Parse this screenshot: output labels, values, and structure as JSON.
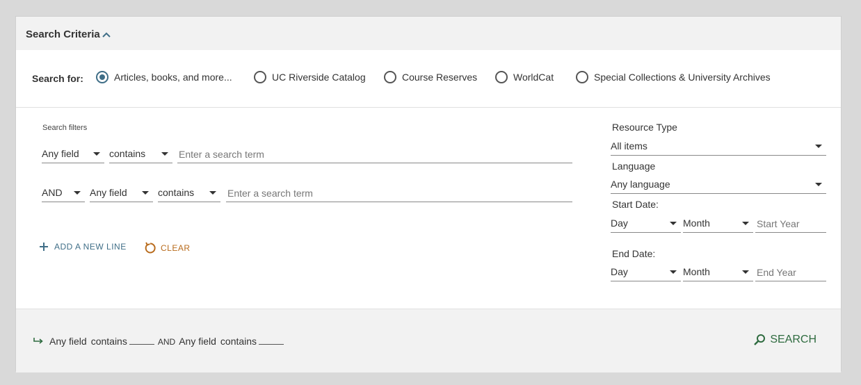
{
  "header": {
    "title": "Search Criteria",
    "icon": "chevron-up-icon"
  },
  "search_for": {
    "label": "Search for:",
    "options": [
      {
        "label": "Articles, books, and more...",
        "selected": true
      },
      {
        "label": "UC Riverside Catalog",
        "selected": false
      },
      {
        "label": "Course Reserves",
        "selected": false
      },
      {
        "label": "WorldCat",
        "selected": false
      },
      {
        "label": "Special Collections & University Archives",
        "selected": false
      }
    ]
  },
  "filters": {
    "label": "Search filters",
    "line1": {
      "field": "Any field",
      "operator": "contains",
      "placeholder": "Enter a search term"
    },
    "line2": {
      "bool": "AND",
      "field": "Any field",
      "operator": "contains",
      "placeholder": "Enter a search term"
    },
    "add_line": "ADD A NEW LINE",
    "clear": "CLEAR"
  },
  "side": {
    "resource_type_label": "Resource Type",
    "resource_type_value": "All items",
    "language_label": "Language",
    "language_value": "Any language",
    "start_date_label": "Start Date:",
    "start_day": "Day",
    "start_month": "Month",
    "start_year_placeholder": "Start Year",
    "end_date_label": "End Date:",
    "end_day": "Day",
    "end_month": "Month",
    "end_year_placeholder": "End Year"
  },
  "footer": {
    "summary_field1": "Any field",
    "summary_op1": "contains",
    "summary_bool": "AND",
    "summary_field2": "Any field",
    "summary_op2": "contains",
    "search_label": "SEARCH"
  },
  "colors": {
    "accent": "#3f6e87",
    "clear": "#b86b1c",
    "search": "#2e6b3f"
  }
}
